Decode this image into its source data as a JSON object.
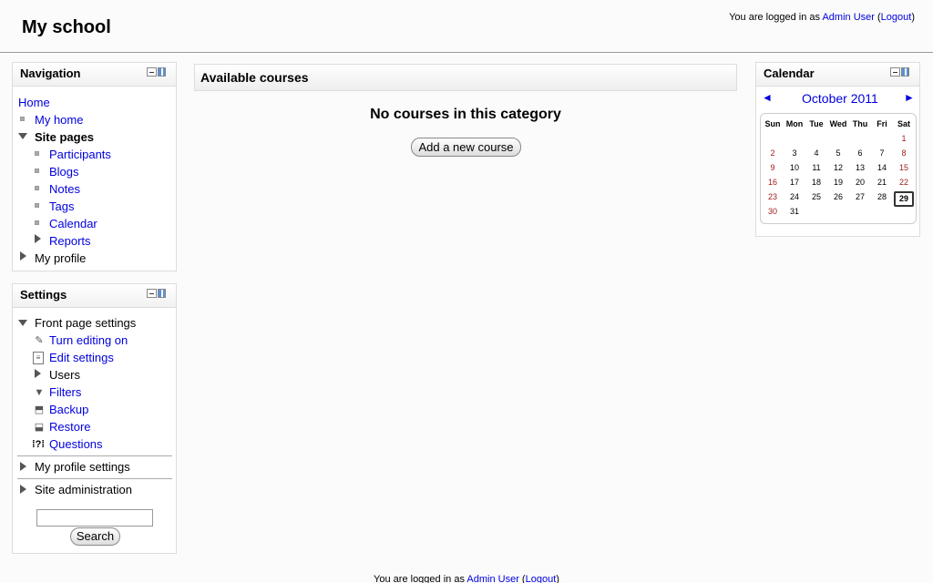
{
  "header": {
    "site_title": "My school",
    "login_prefix": "You are logged in as",
    "user": "Admin User",
    "logout": "Logout"
  },
  "navigation": {
    "title": "Navigation",
    "home": "Home",
    "my_home": "My home",
    "site_pages": "Site pages",
    "items": [
      "Participants",
      "Blogs",
      "Notes",
      "Tags",
      "Calendar",
      "Reports"
    ],
    "my_profile": "My profile"
  },
  "settings": {
    "title": "Settings",
    "front_page": "Front page settings",
    "items": [
      {
        "label": "Turn editing on",
        "icon": "pencil-icon"
      },
      {
        "label": "Edit settings",
        "icon": "document-icon"
      },
      {
        "label": "Users",
        "icon": "expand-arrow"
      },
      {
        "label": "Filters",
        "icon": "filter-icon"
      },
      {
        "label": "Backup",
        "icon": "backup-icon"
      },
      {
        "label": "Restore",
        "icon": "restore-icon"
      },
      {
        "label": "Questions",
        "icon": "questions-icon"
      }
    ],
    "my_profile_settings": "My profile settings",
    "site_administration": "Site administration",
    "search_value": "",
    "search_button": "Search"
  },
  "main": {
    "title": "Available courses",
    "empty_message": "No courses in this category",
    "add_button": "Add a new course"
  },
  "calendar": {
    "title": "Calendar",
    "month": "October 2011",
    "prev": "◄",
    "next": "►",
    "days": [
      "Sun",
      "Mon",
      "Tue",
      "Wed",
      "Thu",
      "Fri",
      "Sat"
    ],
    "weeks": [
      [
        "",
        "",
        "",
        "",
        "",
        "",
        "1"
      ],
      [
        "2",
        "3",
        "4",
        "5",
        "6",
        "7",
        "8"
      ],
      [
        "9",
        "10",
        "11",
        "12",
        "13",
        "14",
        "15"
      ],
      [
        "16",
        "17",
        "18",
        "19",
        "20",
        "21",
        "22"
      ],
      [
        "23",
        "24",
        "25",
        "26",
        "27",
        "28",
        "29"
      ],
      [
        "30",
        "31",
        "",
        "",
        "",
        "",
        ""
      ]
    ],
    "today": "29",
    "weekend_color": "#a01c1c"
  },
  "footer": {
    "login_prefix": "You are logged in as",
    "user": "Admin User",
    "logout": "Logout"
  }
}
